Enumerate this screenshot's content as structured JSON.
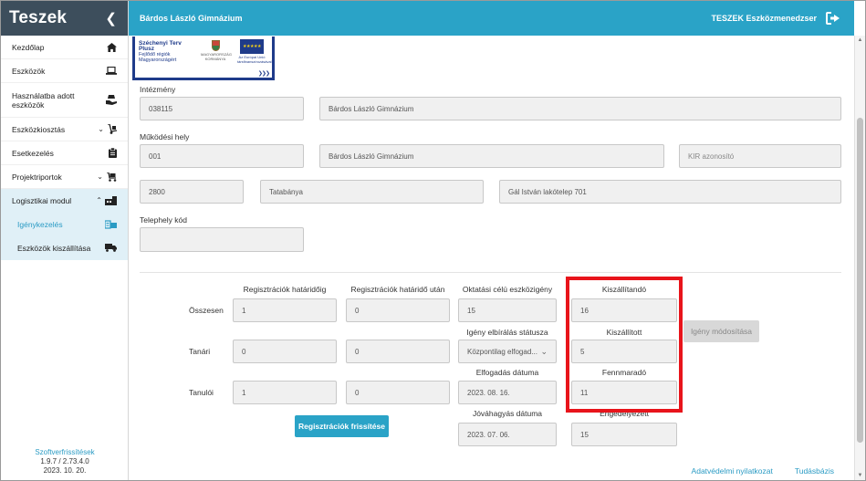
{
  "app": {
    "brand": "Teszek",
    "toggle_icon": "chevron-left-icon"
  },
  "topbar": {
    "school": "Bárdos László Gimnázium",
    "system": "TESZEK Eszközmenedzser",
    "logout_icon": "logout-icon"
  },
  "sidebar": {
    "items": [
      {
        "label": "Kezdőlap",
        "icon": "home-icon"
      },
      {
        "label": "Eszközök",
        "icon": "laptop-icon"
      },
      {
        "label": "Használatba adott eszközök",
        "icon": "box-hand-icon"
      },
      {
        "label": "Eszközkiosztás",
        "icon": "dolly-icon",
        "chevron": "⌄"
      },
      {
        "label": "Esetkezelés",
        "icon": "clipboard-icon"
      },
      {
        "label": "Projektriportok",
        "icon": "report-icon",
        "chevron": "⌄"
      },
      {
        "label": "Logisztikai modul",
        "icon": "warehouse-icon",
        "chevron": "⌃"
      },
      {
        "label": "Igénykezelés",
        "icon": "request-icon"
      },
      {
        "label": "Eszközök kiszállítása",
        "icon": "truck-icon",
        "chevron": "⌄"
      }
    ],
    "footer": {
      "link": "Szoftverfrissítések",
      "version": "1.9.7 / 2.73.4.0",
      "date": "2023. 10. 20."
    }
  },
  "logos": {
    "szechenyi": {
      "title": "Széchenyi Terv Plusz",
      "subtitle": "Fejlődő régiók Magyarországért"
    },
    "gov": {
      "text": "MAGYARORSZÁG KORMÁNYA"
    },
    "eu": {
      "text": "Az Európai Unió társfinanszírozásával",
      "stars": "★★★★★"
    }
  },
  "form": {
    "intezmeny": {
      "label": "Intézmény",
      "code": "038115",
      "name": "Bárdos László Gimnázium"
    },
    "mukodesi_hely": {
      "label": "Működési hely",
      "code": "001",
      "name": "Bárdos László Gimnázium",
      "kir_placeholder": "KIR azonosító"
    },
    "address": {
      "zip": "2800",
      "city": "Tatabánya",
      "street": "Gál István lakótelep 701"
    },
    "telephely": {
      "label": "Telephely kód",
      "value": ""
    }
  },
  "grid": {
    "columns": [
      "Regisztrációk határidőig",
      "Regisztrációk határidő után",
      "Oktatási célú eszközigény"
    ],
    "rows": [
      {
        "label": "Összesen",
        "values": [
          "1",
          "0",
          "15"
        ]
      },
      {
        "label": "Tanári",
        "values": [
          "0",
          "0"
        ]
      },
      {
        "label": "Tanulói",
        "values": [
          "1",
          "0"
        ]
      }
    ],
    "igeny_status": {
      "label": "Igény elbírálás státusza",
      "value": "Központilag elfogad..."
    },
    "elfogadas": {
      "label": "Elfogadás dátuma",
      "value": "2023. 08. 16."
    },
    "jovahagyas": {
      "label": "Jóváhagyás dátuma",
      "value": "2023. 07. 06."
    },
    "kiszallitando": {
      "label": "Kiszállítandó",
      "value": "16"
    },
    "kiszallitott": {
      "label": "Kiszállított",
      "value": "5"
    },
    "fennmarado": {
      "label": "Fennmaradó",
      "value": "11"
    },
    "engedelyezett": {
      "label": "Engedélyezett",
      "value": "15"
    },
    "refresh_button": "Regisztrációk frissítése",
    "modify_button": "Igény módosítása"
  },
  "footer": {
    "privacy": "Adatvédelmi nyilatkozat",
    "kb": "Tudásbázis"
  }
}
